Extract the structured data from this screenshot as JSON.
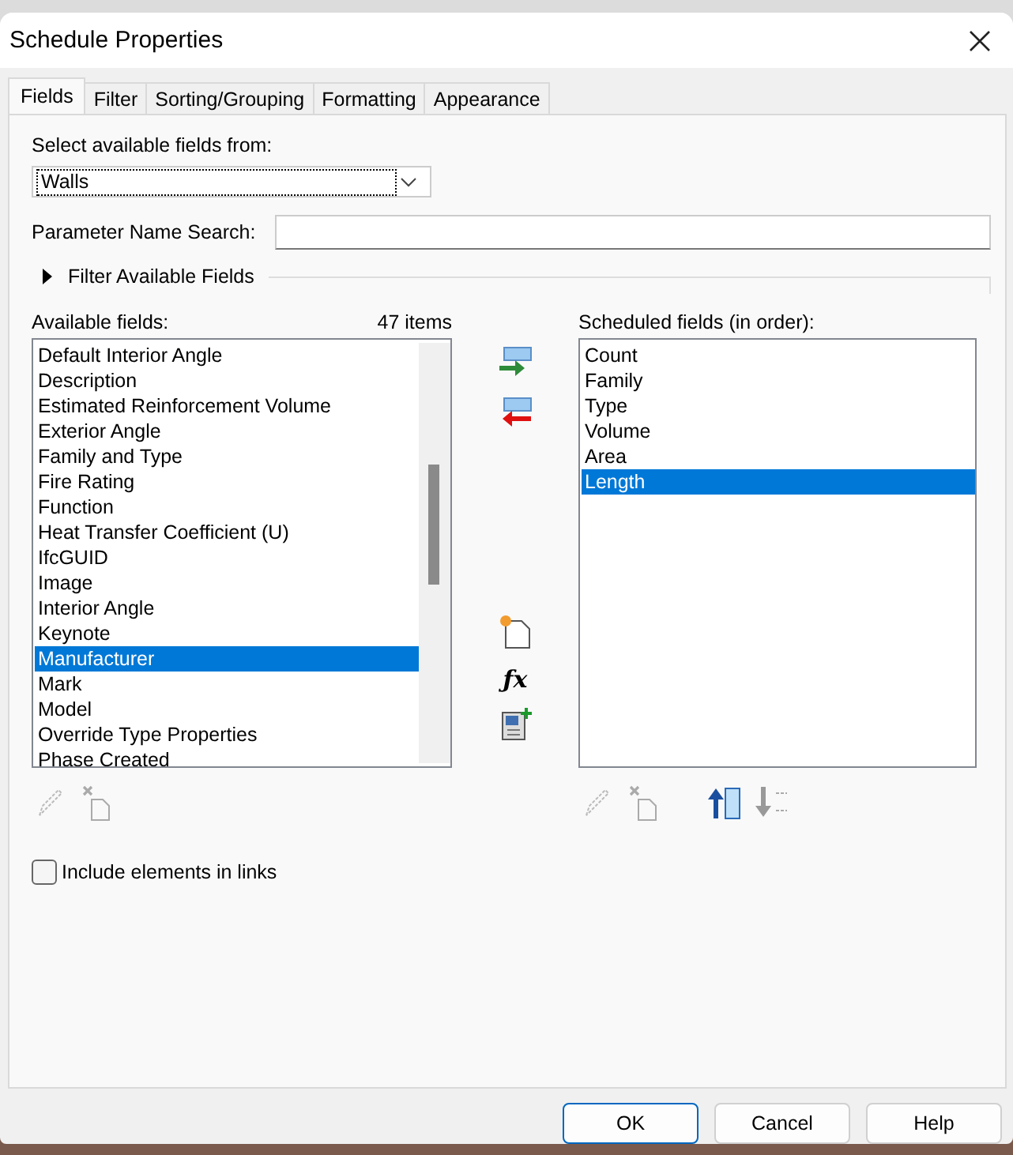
{
  "formula_icon": "ƒx",
  "window": {
    "title": "Schedule Properties"
  },
  "tabs": [
    {
      "label": "Fields",
      "selected": true
    },
    {
      "label": "Filter",
      "selected": false
    },
    {
      "label": "Sorting/Grouping",
      "selected": false
    },
    {
      "label": "Formatting",
      "selected": false
    },
    {
      "label": "Appearance",
      "selected": false
    }
  ],
  "source": {
    "label": "Select available fields from:",
    "value": "Walls"
  },
  "search": {
    "label": "Parameter Name Search:"
  },
  "filter_section": {
    "label": "Filter Available Fields",
    "expanded": false
  },
  "available": {
    "label": "Available fields:",
    "count": "47 items",
    "items": [
      {
        "label": "Default Interior Angle",
        "selected": false
      },
      {
        "label": "Description",
        "selected": false
      },
      {
        "label": "Estimated Reinforcement Volume",
        "selected": false
      },
      {
        "label": "Exterior Angle",
        "selected": false
      },
      {
        "label": "Family and Type",
        "selected": false
      },
      {
        "label": "Fire Rating",
        "selected": false
      },
      {
        "label": "Function",
        "selected": false
      },
      {
        "label": "Heat Transfer Coefficient (U)",
        "selected": false
      },
      {
        "label": "IfcGUID",
        "selected": false
      },
      {
        "label": "Image",
        "selected": false
      },
      {
        "label": "Interior Angle",
        "selected": false
      },
      {
        "label": "Keynote",
        "selected": false
      },
      {
        "label": "Manufacturer",
        "selected": true
      },
      {
        "label": "Mark",
        "selected": false
      },
      {
        "label": "Model",
        "selected": false
      },
      {
        "label": "Override Type Properties",
        "selected": false
      },
      {
        "label": "Phase Created",
        "selected": false
      }
    ]
  },
  "scheduled": {
    "label": "Scheduled fields (in order):",
    "items": [
      {
        "label": "Count",
        "selected": false
      },
      {
        "label": "Family",
        "selected": false
      },
      {
        "label": "Type",
        "selected": false
      },
      {
        "label": "Volume",
        "selected": false
      },
      {
        "label": "Area",
        "selected": false
      },
      {
        "label": "Length",
        "selected": true
      }
    ]
  },
  "include_links": {
    "label": "Include elements in links",
    "checked": false
  },
  "buttons": [
    {
      "label": "OK",
      "kind": "default"
    },
    {
      "label": "Cancel",
      "kind": "normal"
    },
    {
      "label": "Help",
      "kind": "normal"
    }
  ]
}
